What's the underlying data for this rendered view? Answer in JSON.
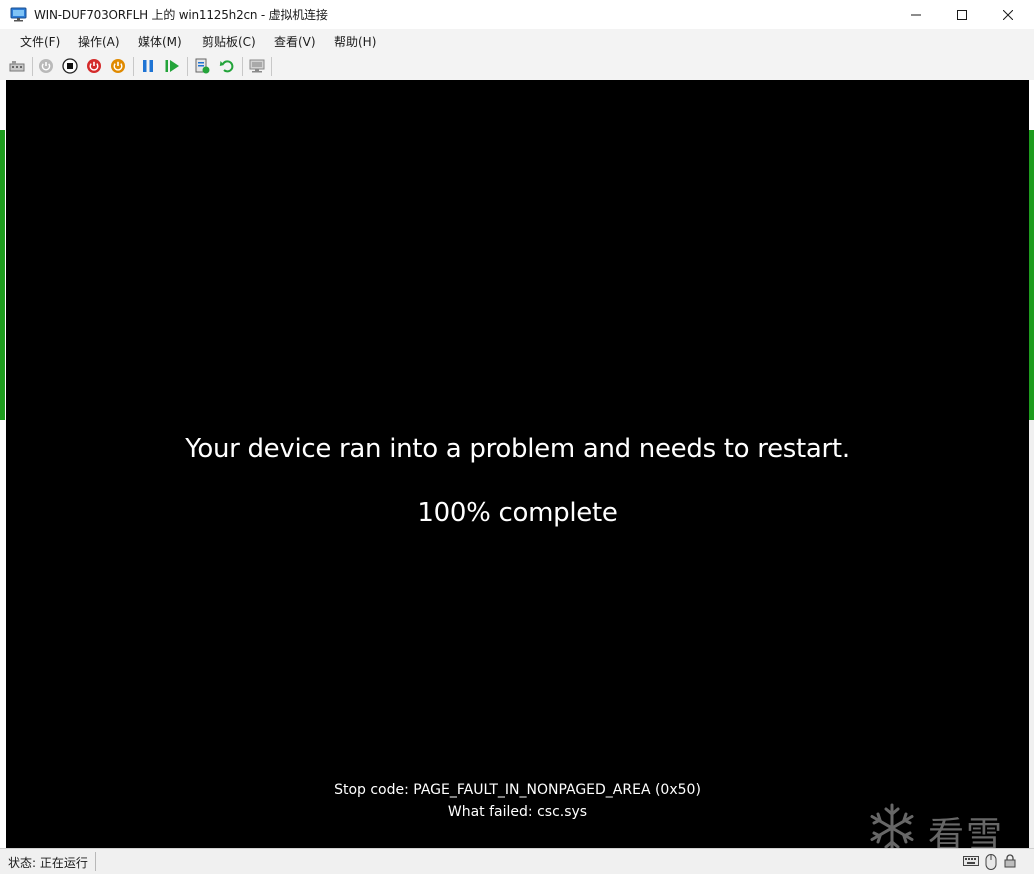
{
  "window": {
    "title": "WIN-DUF703ORFLH 上的 win1125h2cn - 虚拟机连接"
  },
  "menu": {
    "items": [
      "文件(F)",
      "操作(A)",
      "媒体(M)",
      "剪贴板(C)",
      "查看(V)",
      "帮助(H)"
    ]
  },
  "toolbar": {
    "icons": [
      "ctrl-alt-del-icon",
      "start-icon",
      "turn-off-icon",
      "shutdown-icon",
      "reset-icon",
      "pause-icon",
      "resume-icon",
      "checkpoint-icon",
      "revert-icon",
      "enhanced-session-icon"
    ]
  },
  "screen": {
    "message": "Your device ran into a problem and needs to restart.",
    "progress": "100% complete",
    "stop_code": "Stop code: PAGE_FAULT_IN_NONPAGED_AREA (0x50)",
    "what_failed": "What failed: csc.sys"
  },
  "watermark": {
    "text": "看雪"
  },
  "status": {
    "text": "状态: 正在运行"
  },
  "colors": {
    "screen_bg": "#000000",
    "screen_text": "#ffffff",
    "power_red": "#d42a2a",
    "power_orange": "#e08a00",
    "action_blue": "#1f74d4",
    "action_green": "#23a43a"
  }
}
